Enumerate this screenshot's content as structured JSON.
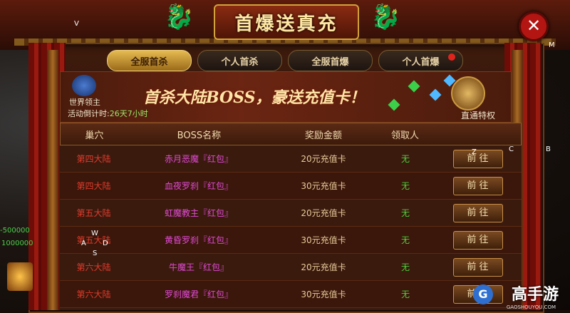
{
  "title": "首爆送真充",
  "close_icon": "✕",
  "tabs": [
    {
      "label": "全服首杀",
      "active": true
    },
    {
      "label": "个人首杀",
      "active": false
    },
    {
      "label": "全服首爆",
      "active": false
    },
    {
      "label": "个人首爆",
      "active": false,
      "dot": true
    }
  ],
  "banner": {
    "headline": "首杀大陆BOSS，豪送充值卡！",
    "world_lord": "世界领主",
    "countdown_label": "活动倒计时:",
    "countdown_value": "26天7小时",
    "vip_label": "直通特权"
  },
  "table": {
    "headers": [
      "巢穴",
      "BOSS名称",
      "奖励金额",
      "领取人",
      ""
    ],
    "rows": [
      {
        "lair": "第四大陆",
        "boss": "赤月恶魔『红包』",
        "reward": "20元充值卡",
        "claimant": "无",
        "action": "前 往"
      },
      {
        "lair": "第四大陆",
        "boss": "血夜罗刹『红包』",
        "reward": "30元充值卡",
        "claimant": "无",
        "action": "前 往"
      },
      {
        "lair": "第五大陆",
        "boss": "虹魔教主『红包』",
        "reward": "20元充值卡",
        "claimant": "无",
        "action": "前 往"
      },
      {
        "lair": "第五大陆",
        "boss": "黄昏罗刹『红包』",
        "reward": "30元充值卡",
        "claimant": "无",
        "action": "前 往"
      },
      {
        "lair": "第六大陆",
        "boss": "牛魔王『红包』",
        "reward": "20元充值卡",
        "claimant": "无",
        "action": "前 往"
      },
      {
        "lair": "第六大陆",
        "boss": "罗刹魔君『红包』",
        "reward": "30元充值卡",
        "claimant": "无",
        "action": "前 往"
      }
    ]
  },
  "side": {
    "v": "V",
    "m": "M",
    "z": "Z",
    "c": "C",
    "b": "B",
    "w": "W",
    "a": "A",
    "d": "D",
    "s": "S",
    "green_1": "-500000",
    "green_2": "1000000"
  },
  "watermark": {
    "name": "高手游",
    "sub": "GAOSHOUYOU.COM",
    "icon": "G"
  },
  "colors": {
    "accent_gold": "#e6bb52",
    "lair_red": "#e03c2c",
    "boss_magenta": "#e14bd6",
    "claimant_green": "#4ecf3c"
  }
}
